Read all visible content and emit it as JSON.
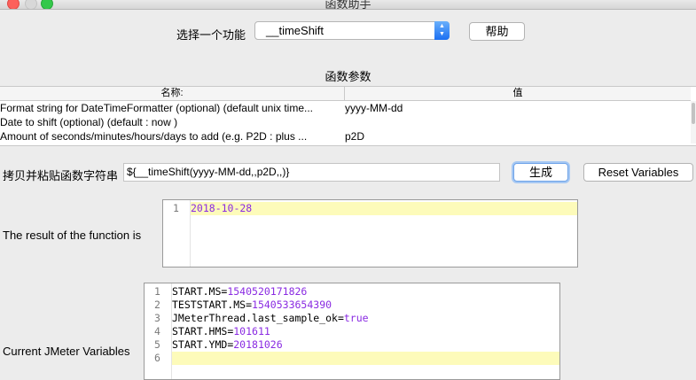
{
  "window": {
    "title": "函数助手"
  },
  "function_select": {
    "label": "选择一个功能",
    "selected": "__timeShift",
    "help_button": "帮助"
  },
  "params": {
    "section_title": "函数参数",
    "col_name": "名称:",
    "col_value": "值",
    "rows": [
      {
        "name": "Format string for DateTimeFormatter (optional) (default unix time...",
        "value": "yyyy-MM-dd"
      },
      {
        "name": "Date to shift (optional) (default : now )",
        "value": ""
      },
      {
        "name": "Amount of seconds/minutes/hours/days to add (e.g. P2D : plus ...",
        "value": "p2D"
      }
    ]
  },
  "copy_paste": {
    "label": "拷贝并粘贴函数字符串",
    "value": "${__timeShift(yyyy-MM-dd,,p2D,,)}",
    "generate_button": "生成",
    "reset_button": "Reset Variables"
  },
  "result": {
    "label": "The result of the function is",
    "lines": [
      {
        "num": "1",
        "text": "2018-10-28"
      }
    ]
  },
  "variables": {
    "label": "Current JMeter Variables",
    "lines": [
      {
        "num": "1",
        "key": "START.MS",
        "value": "1540520171826"
      },
      {
        "num": "2",
        "key": "TESTSTART.MS",
        "value": "1540533654390"
      },
      {
        "num": "3",
        "key": "JMeterThread.last_sample_ok",
        "value": "true"
      },
      {
        "num": "4",
        "key": "START.HMS",
        "value": "101611"
      },
      {
        "num": "5",
        "key": "START.YMD",
        "value": "20181026"
      },
      {
        "num": "6",
        "key": "",
        "value": ""
      }
    ]
  },
  "colors": {
    "value_purple": "#8a2be2",
    "line_highlight": "#fdfbba"
  }
}
